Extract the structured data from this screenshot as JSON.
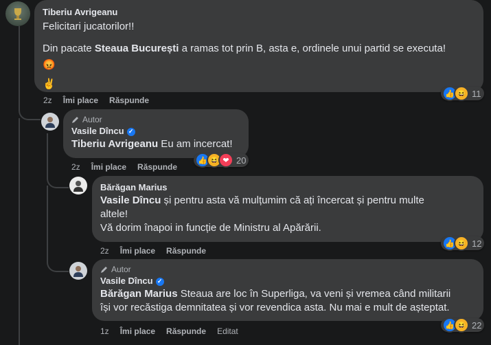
{
  "comment1": {
    "author": "Tiberiu Avrigeanu",
    "line1": "Felicitari jucatorilor!!",
    "line2_pre": "Din pacate ",
    "line2_bold": "Steaua București",
    "line2_post": " a ramas tot prin B, asta e, ordinele unui partid se executa!",
    "emoji1": "😡",
    "emoji2": "✌️",
    "time": "2z",
    "like_label": "Îmi place",
    "reply_label": "Răspunde",
    "reaction_count": "11"
  },
  "reply1": {
    "badge": "Autor",
    "author": "Vasile Dîncu",
    "mention": "Tiberiu Avrigeanu",
    "text": " Eu am incercat!",
    "time": "2z",
    "like_label": "Îmi place",
    "reply_label": "Răspunde",
    "reaction_count": "20"
  },
  "reply2": {
    "author": "Bărăgan Marius",
    "mention": "Vasile Dîncu",
    "text1": " și pentru asta vă mulțumim că ați încercat și pentru multe",
    "text2": "altele!",
    "text3": "Vă dorim înapoi in funcție de Ministru al Apărării.",
    "time": "2z",
    "like_label": "Îmi place",
    "reply_label": "Răspunde",
    "reaction_count": "12"
  },
  "reply3": {
    "badge": "Autor",
    "author": "Vasile Dîncu",
    "mention": "Bărăgan Marius",
    "text1": " Steaua are loc în Superliga, va veni și vremea când militarii",
    "text2": "își vor recăstiga demnitatea și vor revendica asta. Nu mai e mult de așteptat.",
    "time": "1z",
    "like_label": "Îmi place",
    "reply_label": "Răspunde",
    "edited_label": "Editat",
    "reaction_count": "22"
  },
  "icons": {
    "like": "thumbs-up",
    "haha": "laughing-face",
    "love": "heart",
    "badge": "pencil",
    "verified": "check"
  },
  "colors": {
    "background": "#18191a",
    "bubble": "#3a3b3c",
    "like": "#1877f2",
    "love": "#f33e58",
    "haha": "#f7b125"
  }
}
